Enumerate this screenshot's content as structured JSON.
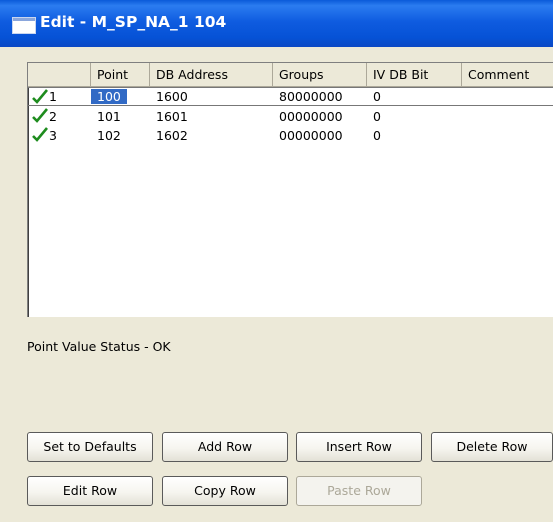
{
  "window": {
    "title": "Edit - M_SP_NA_1 104"
  },
  "table": {
    "columns": [
      "Point",
      "DB Address",
      "Groups",
      "IV DB Bit",
      "Comment"
    ],
    "rows": [
      {
        "index": "1",
        "point": "100",
        "db_address": "1600",
        "groups": "80000000",
        "iv_db_bit": "0",
        "comment": "",
        "status_icon": "check-icon",
        "selected": true
      },
      {
        "index": "2",
        "point": "101",
        "db_address": "1601",
        "groups": "00000000",
        "iv_db_bit": "0",
        "comment": "",
        "status_icon": "check-icon"
      },
      {
        "index": "3",
        "point": "102",
        "db_address": "1602",
        "groups": "00000000",
        "iv_db_bit": "0",
        "comment": "",
        "status_icon": "check-icon"
      }
    ]
  },
  "status": {
    "text": "Point Value Status - OK"
  },
  "buttons": {
    "set_defaults": "Set to Defaults",
    "add_row": "Add Row",
    "insert_row": "Insert Row",
    "delete_row": "Delete Row",
    "edit_row": "Edit Row",
    "copy_row": "Copy Row",
    "paste_row": "Paste Row"
  },
  "colors": {
    "titlebar": "#0a5ad9",
    "selection": "#316ac5",
    "check": "#1e8c1e",
    "face": "#ece9d8"
  }
}
